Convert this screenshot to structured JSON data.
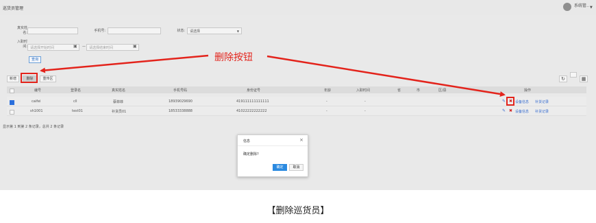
{
  "header": {
    "title": "巡货员管理",
    "user_name": "系统管.."
  },
  "search": {
    "real_name_label": "真实姓\n名:",
    "phone_label": "手机号:",
    "status_label": "状态:",
    "status_value": "请选择",
    "join_time_label": "入职时\n间:",
    "start_placeholder": "请选择开始时间",
    "range_separator": "—",
    "end_placeholder": "请选择结束时间",
    "query_button": "查询"
  },
  "toolbar": {
    "add": "新增",
    "delete": "删除",
    "clear_region": "重传区"
  },
  "table": {
    "columns": [
      "编号",
      "登录名",
      "真实姓名",
      "手机号码",
      "身份证号",
      "年龄",
      "入职时间",
      "省",
      "市",
      "区/县",
      "操作"
    ],
    "rows": [
      {
        "checked": true,
        "id": "caifei",
        "login": "cll",
        "name": "蔡菲菲",
        "phone": "18939029690",
        "idcard": "419111111111111",
        "age": "-",
        "join": "-",
        "actions": [
          "设备信息",
          "补货记录"
        ]
      },
      {
        "checked": false,
        "id": "sh1001",
        "login": "test01",
        "name": "补货员01",
        "phone": "18533338888",
        "idcard": "41022222222222",
        "age": "-",
        "join": "-",
        "actions": [
          "设备信息",
          "补货记录"
        ]
      }
    ],
    "footer": "显示第 1 到第 2 条记录，总共 2 条记录"
  },
  "dialog": {
    "title": "信息",
    "message": "确定删除?",
    "ok": "确定",
    "cancel": "取消"
  },
  "annotation": {
    "text": "删除按钮",
    "color": "#e3231b"
  },
  "caption": "【删除巡货员】"
}
